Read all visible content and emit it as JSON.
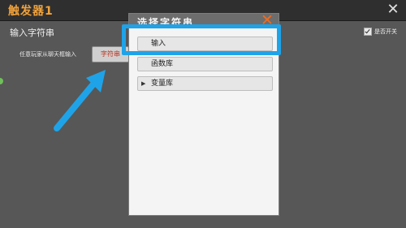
{
  "window": {
    "title": "触发器1",
    "close_icon": "close-icon"
  },
  "panel": {
    "section_title": "输入字符串",
    "description": "任意玩家从聊天框输入",
    "string_button_label": "字符串",
    "checkbox_label": "是否开关",
    "checkbox_checked": true
  },
  "dialog": {
    "title": "选择字符串",
    "options": [
      {
        "label": "输入",
        "expandable": false
      },
      {
        "label": "函数库",
        "expandable": false
      },
      {
        "label": "变量库",
        "expandable": true
      }
    ]
  },
  "colors": {
    "title_accent": "#f2a33a",
    "highlight": "#1fa3e8",
    "dialog_close": "#ef6b1e"
  }
}
